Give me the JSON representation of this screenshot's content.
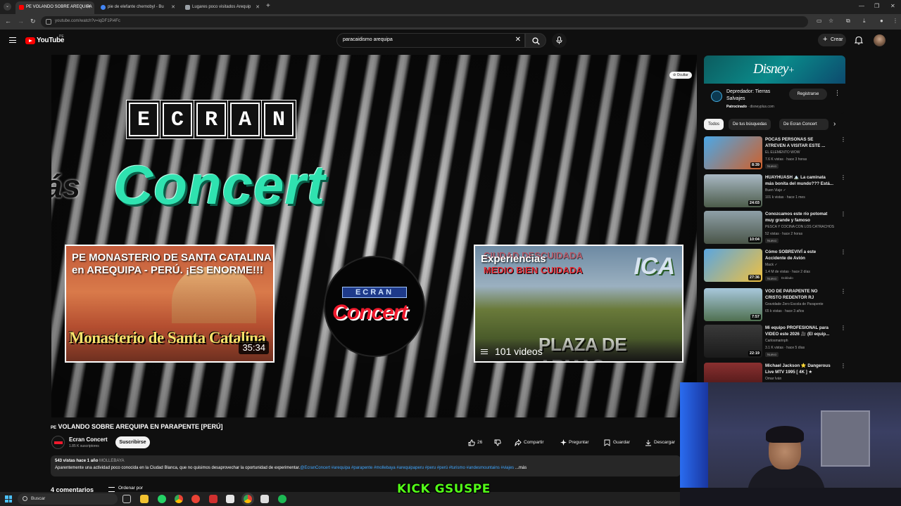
{
  "browser": {
    "tabs": [
      {
        "label": "PE VOLANDO SOBRE AREQUIPA",
        "active": true
      },
      {
        "label": "pie de elefante chernobyl - Bu",
        "active": false
      },
      {
        "label": "Lugares poco visitados Arequip",
        "active": false
      }
    ],
    "url": "youtube.com/watch?v=iqDF1Pi4Fc"
  },
  "header": {
    "logo_text": "YouTube",
    "country": "PE",
    "search_value": "paracaidismo arequipa",
    "create_label": "Crear"
  },
  "player": {
    "hide_label": "Ocultar",
    "ecran_letters": [
      "E",
      "C",
      "R",
      "A",
      "N"
    ],
    "concert_text": "Concert",
    "concert_prefix": "ás",
    "endcard_left": {
      "title": "PE MONASTERIO DE SANTA CATALINA en AREQUIPA - PERÚ. ¡ES ENORME!!!",
      "overlay_text": "Monasterio de Santa Catalina",
      "duration": "35:34"
    },
    "endcard_right": {
      "title": "Experiencias",
      "sub1": "CIUDAD DESCUIDADA",
      "sub2": "MEDIO BIEN CUIDADA",
      "brand": "ICA",
      "plaza": "PLAZA DE ARMAS",
      "playlist_count": "101 videos"
    },
    "circle": {
      "ecran": "ECRAN",
      "concert": "Concert"
    }
  },
  "video": {
    "country_prefix": "PE",
    "title": "VOLANDO SOBRE AREQUIPA EN PARAPENTE [PERÚ]",
    "channel_name": "Ecran Concert",
    "channel_subs": "1.85 K suscriptores",
    "subscribe_label": "Suscribirse",
    "likes": "26",
    "share_label": "Compartir",
    "ask_label": "Preguntar",
    "save_label": "Guardar",
    "download_label": "Descargar",
    "meta": "543 vistas  hace 1 año",
    "location": "MOLLEBAYA",
    "description": "Aparentemente una actividad poco conocida en la Ciudad Blanca, que no quisimos desaprovechar la oportunidad de experimentar.",
    "tags": "@EcranConcert #arequipa #parapente #mollebaya #arequipaperu #peru #perú #turismo #andesmountains #viajes",
    "more_label": "...más",
    "comments_count": "4 comentarios",
    "sort_label": "Ordenar por"
  },
  "ad": {
    "brand": "Disney",
    "brand_plus": "+",
    "title": "Depredador: Tierras Salvajes",
    "sponsored": "Patrocinado",
    "domain": "disneyplus.com",
    "register_label": "Registrarse"
  },
  "chips": [
    "Todos",
    "De tus búsquedas",
    "De Ecran Concert"
  ],
  "recommendations": [
    {
      "title": "POCAS PERSONAS SE ATREVEN A VISITAR ESTE ...",
      "channel": "EL ELEMENTO WOW",
      "stats": "7.6 K vistas · hace 3 horas",
      "badge": "Nuevo",
      "badge2": "",
      "duration": "8:39",
      "thumb_color": "#3a8fd6"
    },
    {
      "title": "HUAYHUASH 🏔️ La caminata más bonita del mundo??? Está...",
      "channel": "Buen Viaje ✓",
      "stats": "101 k vistas · hace 1 mes",
      "badge": "",
      "badge2": "",
      "duration": "24:03",
      "thumb_color": "#6b7d8a"
    },
    {
      "title": "Conozcamos este río potomat muy grande y famoso",
      "channel": "PESCA Y COCINA CON LOS CATRACHOS",
      "stats": "52 vistas · hace 2 horas",
      "badge": "Nuevo",
      "badge2": "",
      "duration": "10:04",
      "thumb_color": "#5f6b5a"
    },
    {
      "title": "Cómo SOBREVIVÍ a este Accidente de Avión",
      "channel": "Mack ✓",
      "stats": "1.4 M de vistas · hace 2 días",
      "badge": "Nuevo",
      "badge2": "Doblado",
      "duration": "27:36",
      "thumb_color": "#d9a23a"
    },
    {
      "title": "VOO DE PARAPENTE NO CRISTO REDENTOR RJ",
      "channel": "Gravidade Zero Escola de Parapente",
      "stats": "65 k vistas · hace 3 años",
      "badge": "",
      "badge2": "",
      "duration": "7:57",
      "thumb_color": "#7ea3b8"
    },
    {
      "title": "Mi equipo PROFESIONAL para VIDEO este 2026 🎥 (El equip...",
      "channel": "Carlosmarinph",
      "stats": "3.1 K vistas · hace 5 días",
      "badge": "Nuevo",
      "badge2": "",
      "duration": "22:19",
      "thumb_color": "#2c2c2c"
    },
    {
      "title": "Michael Jackson ⭐ Dangerous Live MTV 1995 [ 4K ] ★",
      "channel": "Omar Iván",
      "stats": "",
      "badge": "",
      "badge2": "",
      "duration": "",
      "thumb_color": "#7a2a2a"
    }
  ],
  "taskbar": {
    "search_placeholder": "Buscar"
  },
  "overlay": {
    "kick": "KICK GSUSPE"
  }
}
